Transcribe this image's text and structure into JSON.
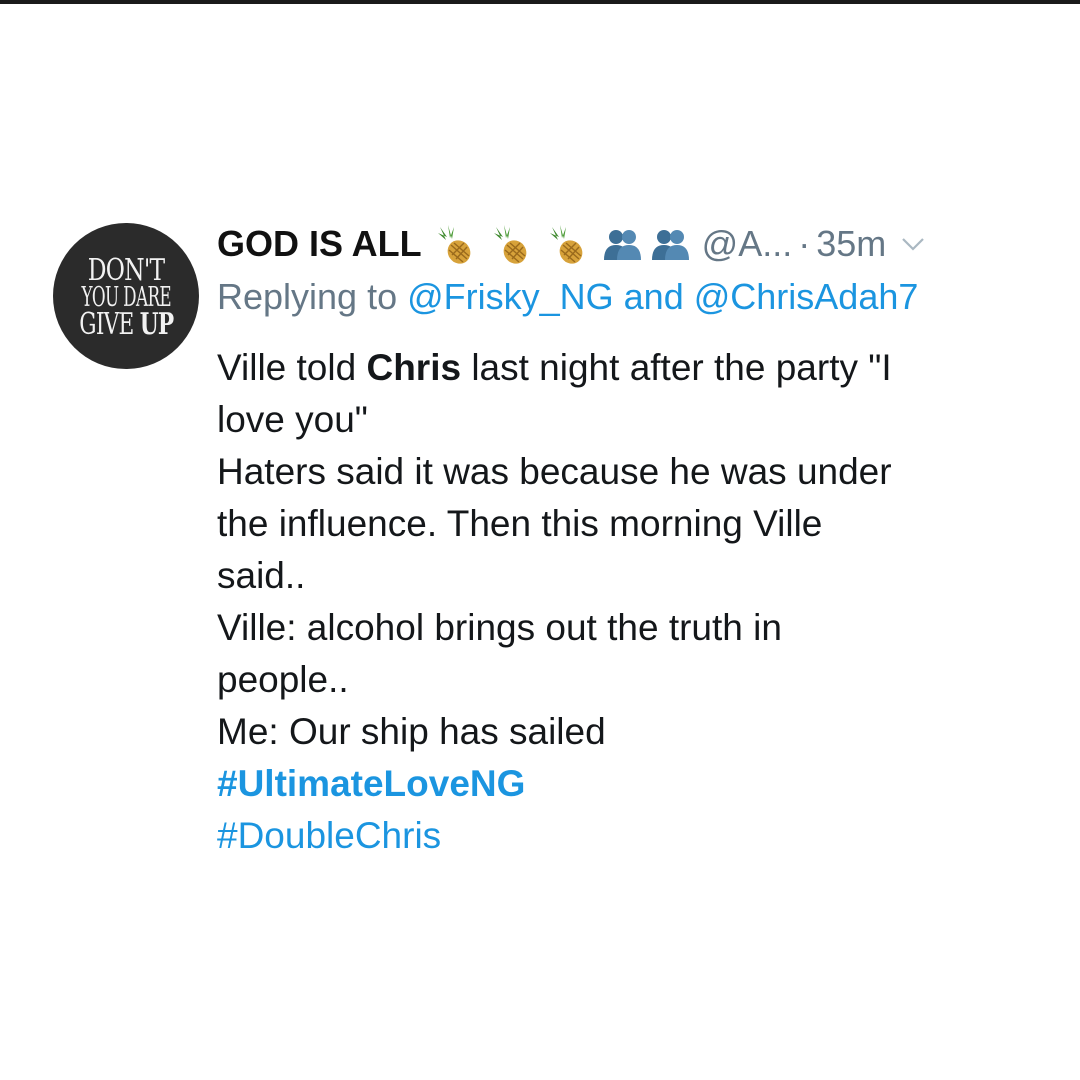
{
  "tweet": {
    "avatar": {
      "line1": "DON'T",
      "line2": "YOU DARE",
      "line3_a": "GIVE ",
      "line3_b": "UP"
    },
    "display_name": "GOD IS ALL",
    "name_emojis": [
      "pineapple-icon",
      "pineapple-icon",
      "pineapple-icon",
      "people-icon",
      "people-icon"
    ],
    "handle": "@A...",
    "separator": "·",
    "time": "35m",
    "reply": {
      "prefix": "Replying to ",
      "mention1": "@Frisky_NG",
      "joiner": " and ",
      "mention2": "@ChrisAdah7"
    },
    "body": {
      "l1_a": "Ville told ",
      "l1_bold": "Chris",
      "l1_b": " last night after the party \"I",
      "l2": "love you\"",
      "l3": "Haters said it was because he was under",
      "l4": "the influence. Then this morning Ville",
      "l5": "said..",
      "l6": "Ville: alcohol brings out the truth in",
      "l7": "people..",
      "l8": "Me: Our ship has sailed"
    },
    "hashtags": [
      "#UltimateLoveNG",
      "#DoubleChris"
    ]
  },
  "colors": {
    "link": "#1b95e0",
    "secondary": "#657786",
    "text": "#14171a"
  }
}
